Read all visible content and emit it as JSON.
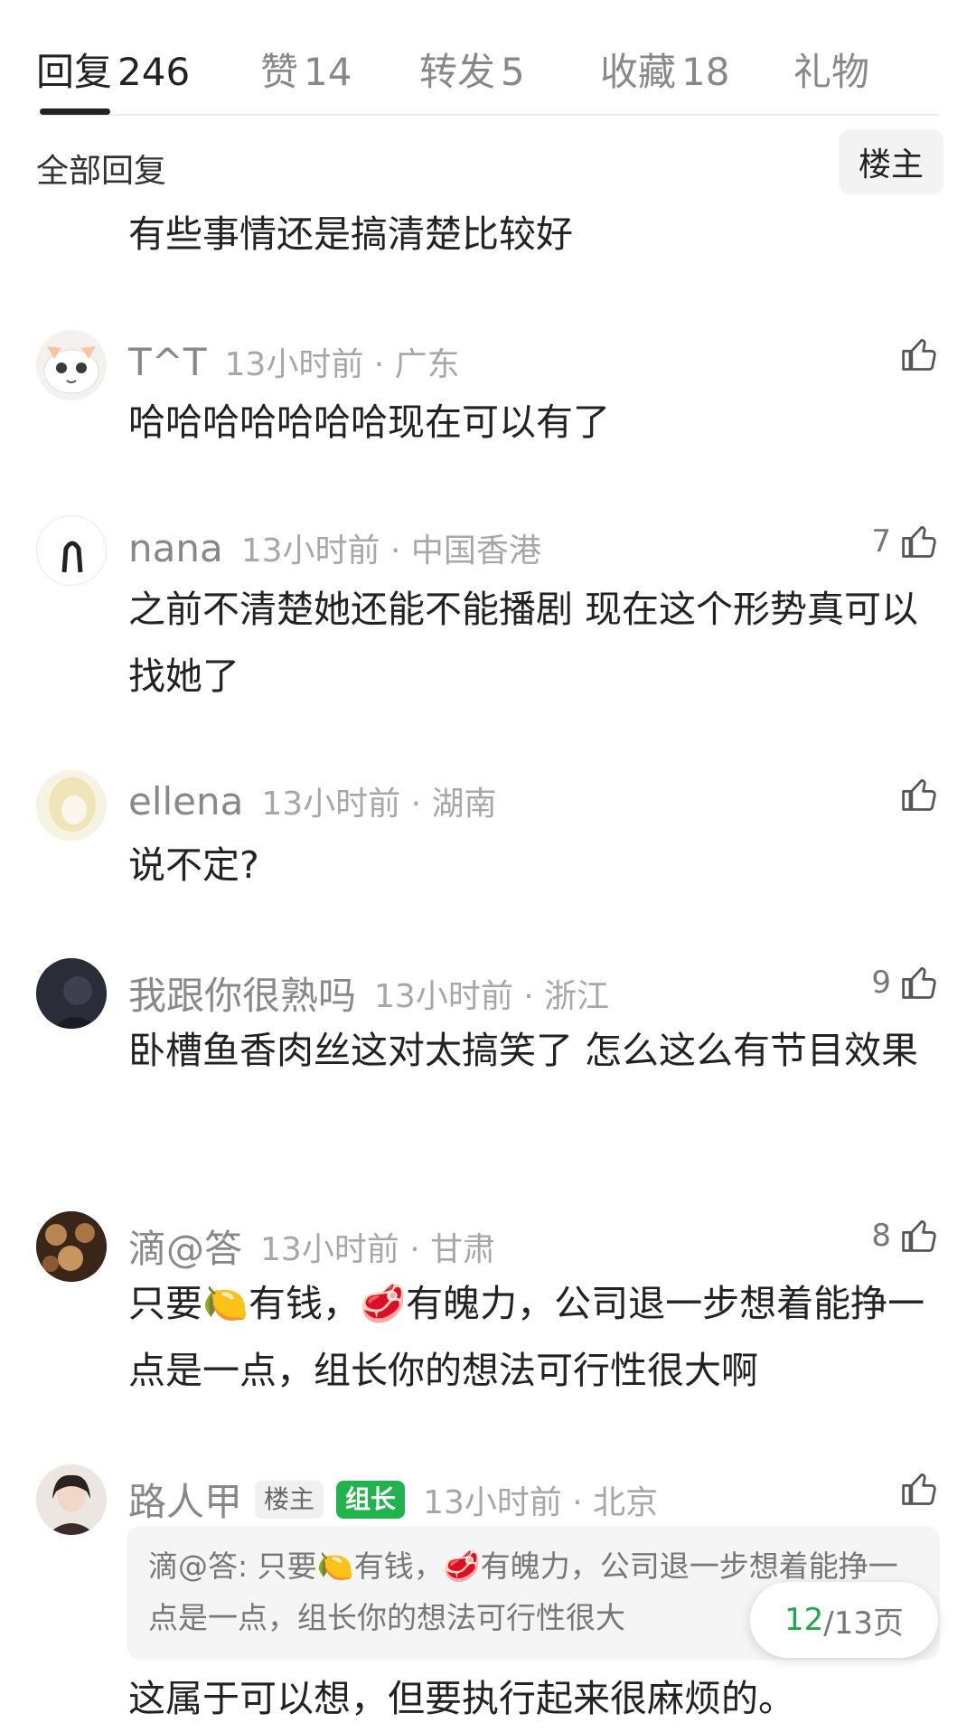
{
  "tabs": [
    {
      "label": "回复",
      "count": "246"
    },
    {
      "label": "赞",
      "count": "14"
    },
    {
      "label": "转发",
      "count": "5"
    },
    {
      "label": "收藏",
      "count": "18"
    },
    {
      "label": "礼物",
      "count": ""
    }
  ],
  "section": {
    "title": "全部回复",
    "filter_label": "楼主"
  },
  "prev_comment_tail": "有些事情还是搞清楚比较好",
  "comments": [
    {
      "username": "T^T",
      "meta": "13小时前 · 广东",
      "text": "哈哈哈哈哈哈哈现在可以有了",
      "likes": ""
    },
    {
      "username": "nana",
      "meta": "13小时前 · 中国香港",
      "text": "之前不清楚她还能不能播剧 现在这个形势真可以找她了",
      "likes": "7"
    },
    {
      "username": "ellena",
      "meta": "13小时前 · 湖南",
      "text": "说不定?",
      "likes": ""
    },
    {
      "username": "我跟你很熟吗",
      "meta": "13小时前 · 浙江",
      "text": "卧槽鱼香肉丝这对太搞笑了 怎么这么有节目效果",
      "likes": "9"
    },
    {
      "username": "滴@答",
      "meta": "13小时前 · 甘肃",
      "text": "只要🍋有钱，🥩有魄力，公司退一步想着能挣一点是一点，组长你的想法可行性很大啊",
      "likes": "8"
    },
    {
      "username": "路人甲",
      "tag_op": "楼主",
      "tag_leader": "组长",
      "meta": "13小时前 · 北京",
      "likes": "",
      "quote": "滴@答: 只要🍋有钱，🥩有魄力，公司退一步想着能挣一点是一点，组长你的想法可行性很大",
      "text": "这属于可以想，但要执行起来很麻烦的。"
    }
  ],
  "pager": {
    "current": "12",
    "total": "/13页"
  }
}
